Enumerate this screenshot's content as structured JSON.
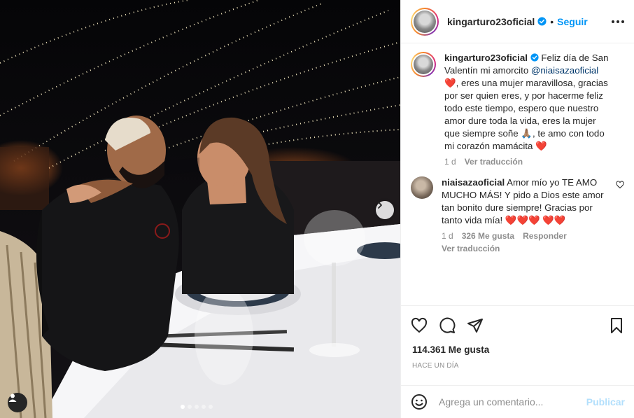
{
  "post": {
    "username": "kingarturo23oficial",
    "follow_label": "Seguir",
    "separator": "•"
  },
  "caption": {
    "username": "kingarturo23oficial",
    "text_before_mention": "Feliz día de San Valentín mi amorcito ",
    "mention": "@niaisazaoficial",
    "text_after_mention_1": ", eres una mujer maravillosa, gracias por ser quien eres, y por hacerme feliz todo este tiempo, espero que nuestro amor dure toda la vida, eres la mujer que siempre soñe ",
    "text_after_mention_2": ", te amo con todo mi corazón mamácita ",
    "emoji_heart": "❤️",
    "emoji_pray": "🙏🏽",
    "age": "1 d",
    "translate": "Ver traducción"
  },
  "reply": {
    "username": "niaisazaoficial",
    "text": "Amor mío yo TE AMO MUCHO MÁS! Y pido a Dios este amor tan bonito dure siempre! Gracias por tanto vida mía! ",
    "hearts": "❤️❤️❤️ ❤️❤️",
    "age": "1 d",
    "likes": "326 Me gusta",
    "reply_label": "Responder",
    "translate": "Ver traducción"
  },
  "stats": {
    "likes": "114.361 Me gusta",
    "time": "HACE UN DÍA"
  },
  "composer": {
    "placeholder": "Agrega un comentario...",
    "publish_label": "Publicar"
  },
  "carousel": {
    "dot_count": 5,
    "active_index": 0
  },
  "colors": {
    "accent": "#0095f6",
    "publish_disabled": "#b2dffc",
    "verified": "#0095f6",
    "heart": "#ed4956"
  },
  "icons": [
    "more-options-icon",
    "heart-icon",
    "comment-icon",
    "share-icon",
    "bookmark-icon",
    "emoji-icon",
    "chevron-right-icon",
    "tag-user-icon",
    "verified-badge-icon"
  ]
}
